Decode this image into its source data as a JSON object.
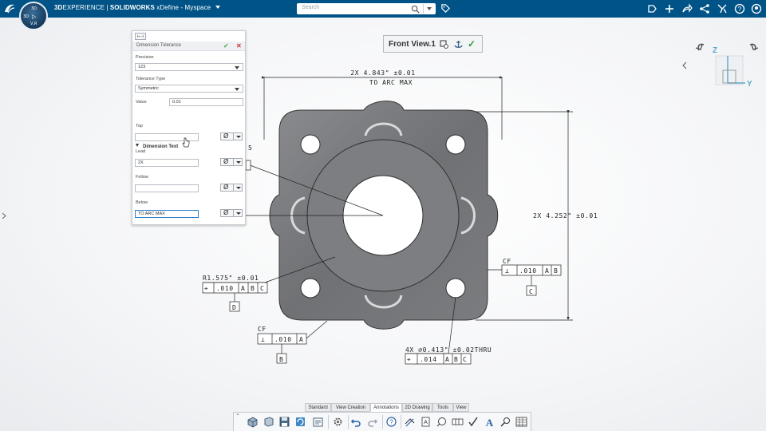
{
  "topbar": {
    "brand_bold": "3D",
    "brand_rest": "EXPERIENCE | ",
    "brand_app": "SOLIDWORKS",
    "brand_context": " xDefine - Myspace",
    "search_placeholder": "Search",
    "compass_labels": {
      "top": "3D",
      "left": "3D",
      "right": "▷",
      "bottom": "V,R"
    }
  },
  "panel": {
    "tab_icon": "dimension-icon",
    "title": "Dimension Tolerance",
    "precision_label": "Precision",
    "precision_value": "123",
    "tolerance_type_label": "Tolerance Type",
    "tolerance_type_value": "Symmetric",
    "value_label": "Value",
    "value_value": "0.01",
    "dimension_text_label": "Dimension Text",
    "top_label": "Top",
    "top_value": "",
    "lead_label": "Lead",
    "lead_value": "2X",
    "follow_label": "Follow",
    "follow_value": "",
    "below_label": "Below",
    "below_value": "TO ARC MAX",
    "diameter_symbol": "Ø"
  },
  "view": {
    "title": "Front View.1"
  },
  "triad": {
    "z": "Z",
    "y": "Y"
  },
  "annotations": {
    "top_dim_line1": "2X 4.843\" ±0.01",
    "top_dim_line2": "TO ARC MAX",
    "right_dim": "2X 4.252\" ±0.01",
    "radius": "R1.575\" ±0.01",
    "fcf_left": {
      "sym": "⌖",
      "tol": ".010",
      "a": "A",
      "b": "B",
      "c": "C"
    },
    "datum_d": "D",
    "cf_bottom_left": "CF",
    "fcf_bottom_left": {
      "sym": "⊥",
      "tol": ".010",
      "a": "A"
    },
    "datum_b": "B",
    "cf_right": "CF",
    "fcf_right": {
      "sym": "⊥",
      "tol": ".010",
      "a": "A",
      "b": "B"
    },
    "datum_c": "C",
    "hole_note": "4X ∅0.413\" ±0.02THRU",
    "fcf_hole": {
      "sym": "⌖",
      "tol": ".014",
      "a": "A",
      "b": "B",
      "c": "C"
    },
    "partial_number": "5"
  },
  "bottom_tabs": [
    "Standard",
    "View Creation",
    "Annotations",
    "2D Drawing",
    "Tools",
    "View"
  ],
  "active_tab": "Annotations"
}
